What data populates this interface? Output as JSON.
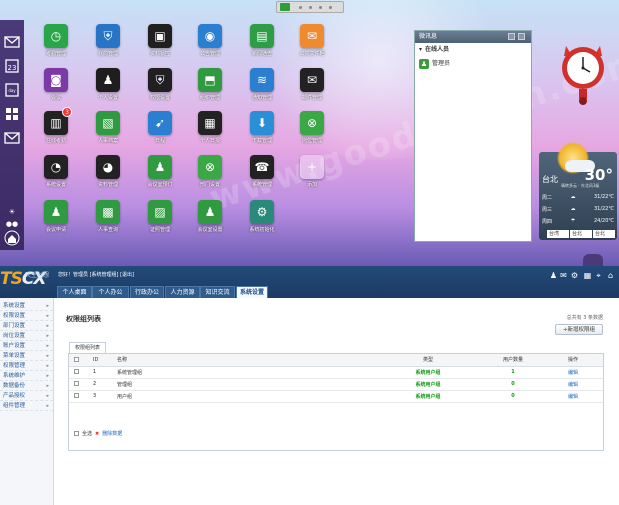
{
  "desktop": {
    "watermark": "www.goodziyuan.com",
    "icons": [
      {
        "label": "考勤管理",
        "icon": "clock-icon",
        "color": "#2aa64a"
      },
      {
        "label": "我的管理",
        "icon": "user-shield-icon",
        "color": "#2874c6"
      },
      {
        "label": "资料锁控",
        "icon": "lock-icon",
        "color": "#202020"
      },
      {
        "label": "公告管理",
        "icon": "speaker-icon",
        "color": "#2b7fd0"
      },
      {
        "label": "新闻通告",
        "icon": "newspaper-icon",
        "color": "#2e9e46"
      },
      {
        "label": "公共文件柜",
        "icon": "mail-icon",
        "color": "#ef8a2f"
      },
      {
        "label": "会议",
        "icon": "chat-icon",
        "color": "#7b3aa8"
      },
      {
        "label": "个人设置",
        "icon": "person-icon",
        "color": "#1e1e1e"
      },
      {
        "label": "权限设置",
        "icon": "shield-icon",
        "color": "#202020"
      },
      {
        "label": "组织管理",
        "icon": "org-icon",
        "color": "#2f9a3f"
      },
      {
        "label": "通知管理",
        "icon": "wave-icon",
        "color": "#2b7fd0"
      },
      {
        "label": "邮件管理",
        "icon": "envelope-icon",
        "color": "#222"
      },
      {
        "label": "在线考勤",
        "icon": "clipboard-icon",
        "color": "#222",
        "badge": "3"
      },
      {
        "label": "人事档案",
        "icon": "folder-icon",
        "color": "#2f9a3f"
      },
      {
        "label": "日程",
        "icon": "run-icon",
        "color": "#2b7fd0"
      },
      {
        "label": "个人日报",
        "icon": "grid-icon",
        "color": "#222"
      },
      {
        "label": "下载管理",
        "icon": "download-icon",
        "color": "#2b8fd8"
      },
      {
        "label": "岗位管理",
        "icon": "xbox-icon",
        "color": "#3aa845"
      },
      {
        "label": "系统设置",
        "icon": "gauge-icon",
        "color": "#222"
      },
      {
        "label": "资料管理",
        "icon": "speedometer-icon",
        "color": "#222"
      },
      {
        "label": "会议室预订",
        "icon": "people-icon",
        "color": "#2f9a3f"
      },
      {
        "label": "部门设置",
        "icon": "xbox-icon",
        "color": "#3aa845"
      },
      {
        "label": "系统管理",
        "icon": "phone-icon",
        "color": "#222"
      },
      {
        "label": "添加",
        "icon": "plus-icon",
        "color": "rgba(255,255,255,.35)"
      },
      {
        "label": "会议申请",
        "icon": "people-icon",
        "color": "#2f9a3f"
      },
      {
        "label": "人事查询",
        "icon": "windows-icon",
        "color": "#2f9a3f"
      },
      {
        "label": "证照管理",
        "icon": "id-card-icon",
        "color": "#2f9a3f"
      },
      {
        "label": "会议室设置",
        "icon": "people-icon",
        "color": "#2f9a3f"
      },
      {
        "label": "系统初始化",
        "icon": "gear-icon",
        "color": "#2a8a7a"
      }
    ]
  },
  "chat": {
    "title": "微讯息",
    "group": "在线人员",
    "user": "管理员"
  },
  "weather": {
    "temp": "30°",
    "city": "台北",
    "sub": "晴转多云 · 东北风3级",
    "forecast": [
      {
        "day": "周二",
        "range": "31/22℃"
      },
      {
        "day": "周三",
        "range": "31/22℃"
      },
      {
        "day": "周四",
        "range": "24/20℃"
      }
    ],
    "selects": [
      "台湾",
      "台北",
      "台北"
    ]
  },
  "app": {
    "logo_a": "TS",
    "logo_b": "CX",
    "slogan": "天生创想",
    "welcome": "您好！管理员 [系统管理组]  [退出]",
    "tabs": [
      "个人桌面",
      "个人办公",
      "行政办公",
      "人力资源",
      "知识交流",
      "系统设置"
    ],
    "active_tab": 5,
    "sidebar": [
      "系统设置",
      "权限设置",
      "部门设置",
      "岗位设置",
      "账户设置",
      "菜单设置",
      "权限管理",
      "系统维护",
      "数据备份",
      "产品授权",
      "组件管理"
    ],
    "page_title": "权限组列表",
    "page_info": "总共有 3 条数据",
    "add_button": "新增权限组",
    "table_tab": "权限组列表",
    "columns": [
      "",
      "ID",
      "名称",
      "类型",
      "用户数量",
      "操作"
    ],
    "rows": [
      {
        "id": "1",
        "name": "系统管理组",
        "type": "系统用户组",
        "count": "1",
        "op": "编辑"
      },
      {
        "id": "2",
        "name": "管理组",
        "type": "系统用户组",
        "count": "0",
        "op": "编辑"
      },
      {
        "id": "3",
        "name": "用户组",
        "type": "系统用户组",
        "count": "0",
        "op": "编辑"
      }
    ],
    "select_all": "全选",
    "delete_selected": "删除数据"
  }
}
